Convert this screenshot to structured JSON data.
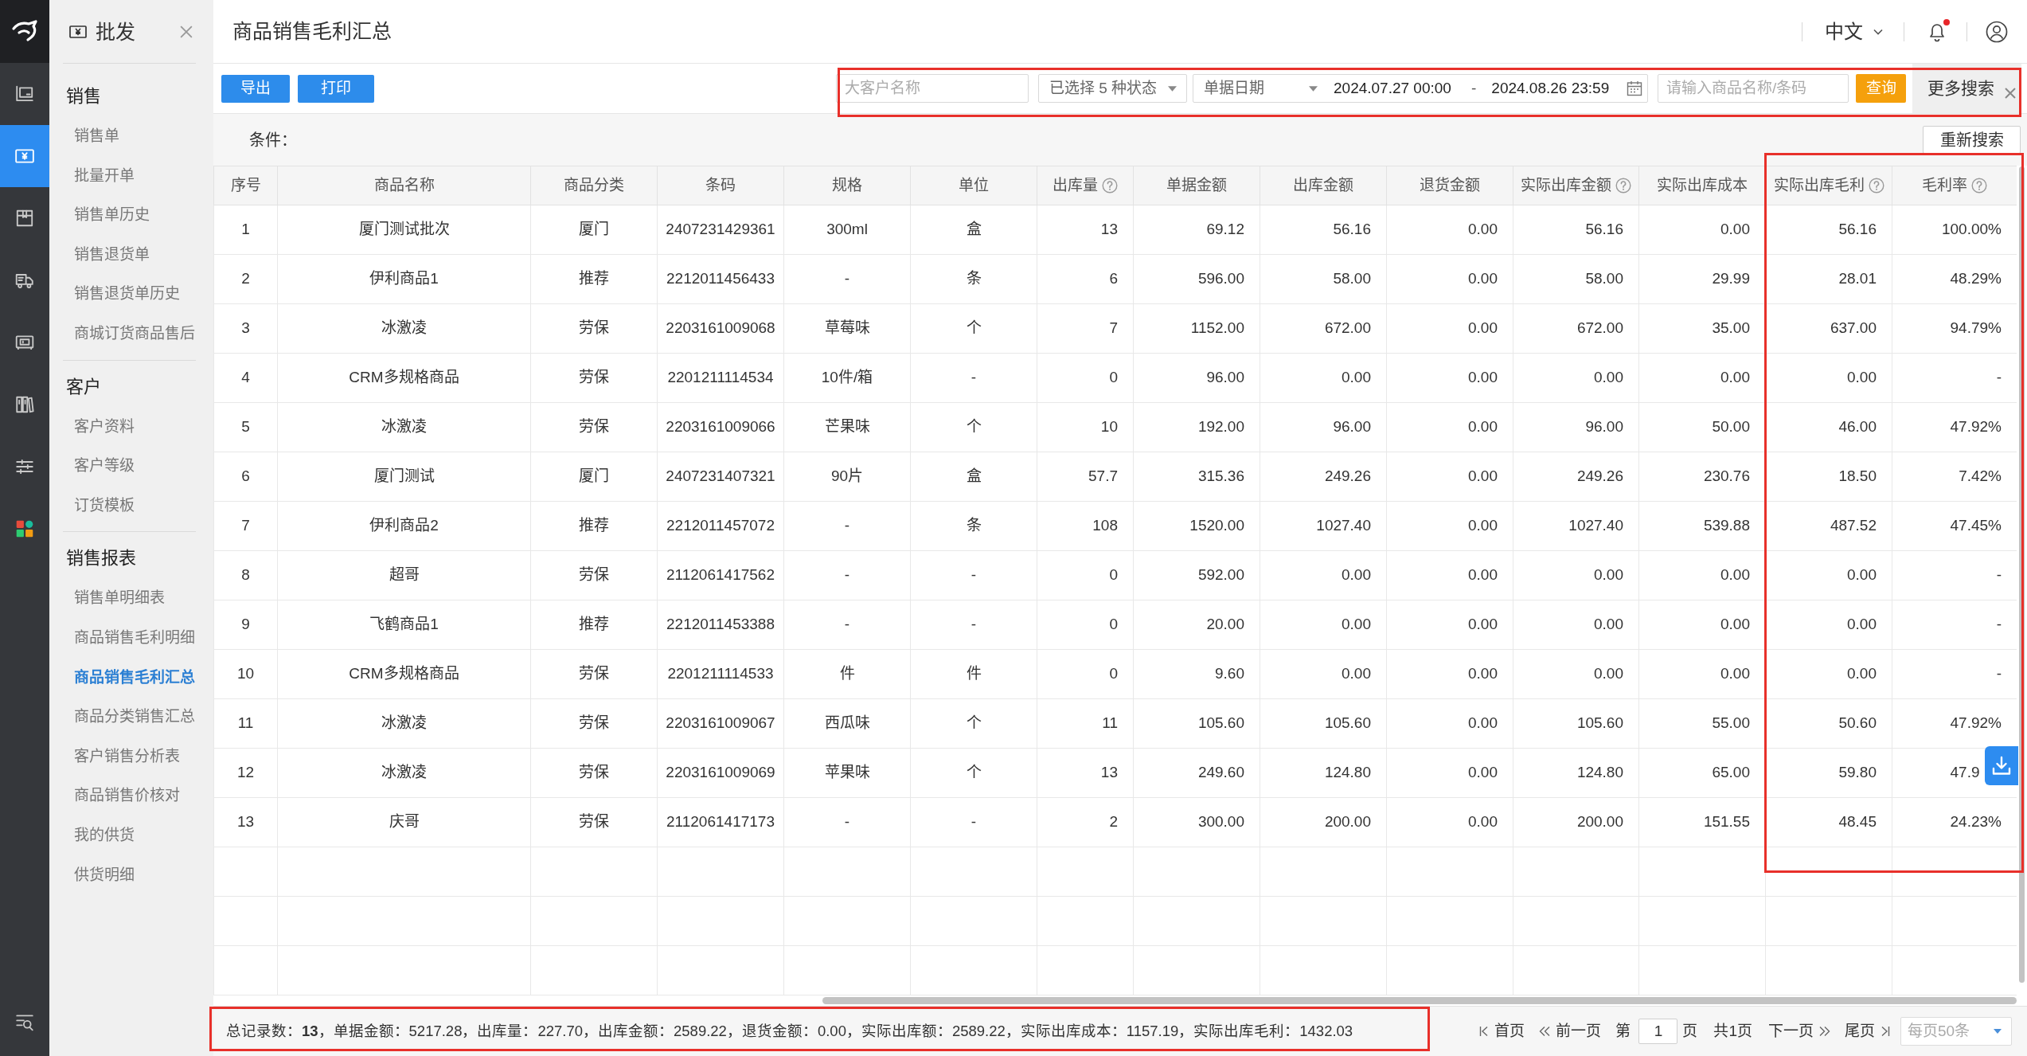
{
  "rail": {
    "items": [
      {
        "selected": false
      },
      {
        "selected": true
      },
      {
        "selected": false
      },
      {
        "selected": false
      },
      {
        "selected": false
      },
      {
        "selected": false
      },
      {
        "selected": false
      },
      {
        "selected": false
      }
    ]
  },
  "sidebar": {
    "title": "批发",
    "sections": [
      {
        "title": "销售",
        "items": [
          {
            "label": "销售单",
            "selected": false
          },
          {
            "label": "批量开单",
            "selected": false
          },
          {
            "label": "销售单历史",
            "selected": false
          },
          {
            "label": "销售退货单",
            "selected": false
          },
          {
            "label": "销售退货单历史",
            "selected": false
          },
          {
            "label": "商城订货商品售后",
            "selected": false
          }
        ]
      },
      {
        "title": "客户",
        "items": [
          {
            "label": "客户资料",
            "selected": false
          },
          {
            "label": "客户等级",
            "selected": false
          },
          {
            "label": "订货模板",
            "selected": false
          }
        ]
      },
      {
        "title": "销售报表",
        "items": [
          {
            "label": "销售单明细表",
            "selected": false
          },
          {
            "label": "商品销售毛利明细",
            "selected": false
          },
          {
            "label": "商品销售毛利汇总",
            "selected": true
          },
          {
            "label": "商品分类销售汇总",
            "selected": false
          },
          {
            "label": "客户销售分析表",
            "selected": false
          },
          {
            "label": "商品销售价核对",
            "selected": false
          },
          {
            "label": "我的供货",
            "selected": false
          },
          {
            "label": "供货明细",
            "selected": false
          }
        ]
      }
    ]
  },
  "header": {
    "title": "商品销售毛利汇总",
    "language": "中文",
    "notifications": {
      "unread": true
    }
  },
  "toolbar": {
    "buttons": [
      "导出",
      "打印"
    ]
  },
  "filter_bar": {
    "highlighted": true,
    "customer": {
      "placeholder": "大客户名称"
    },
    "status": {
      "value": "已选择 5 种状态"
    },
    "date_type": {
      "value": "单据日期"
    },
    "date_from": "2024.07.27 00:00",
    "date_separator": "-",
    "date_to": "2024.08.26 23:59",
    "product": {
      "placeholder": "请输入商品名称/条码"
    },
    "search_button": "查询",
    "more_button": "更多搜索"
  },
  "conditions": {
    "label": "条件：",
    "reset_button": "重新搜索"
  },
  "table": {
    "columns": [
      {
        "label": "序号",
        "kind": "text",
        "help": false,
        "highlighted": false
      },
      {
        "label": "商品名称",
        "kind": "text",
        "help": false,
        "highlighted": false
      },
      {
        "label": "商品分类",
        "kind": "text",
        "help": false,
        "highlighted": false
      },
      {
        "label": "条码",
        "kind": "text",
        "help": false,
        "highlighted": false
      },
      {
        "label": "规格",
        "kind": "text",
        "help": false,
        "highlighted": false
      },
      {
        "label": "单位",
        "kind": "text",
        "help": false,
        "highlighted": false
      },
      {
        "label": "出库量",
        "kind": "number",
        "help": true,
        "highlighted": false
      },
      {
        "label": "单据金额",
        "kind": "number",
        "help": false,
        "highlighted": false
      },
      {
        "label": "出库金额",
        "kind": "number",
        "help": false,
        "highlighted": false
      },
      {
        "label": "退货金额",
        "kind": "number",
        "help": false,
        "highlighted": false
      },
      {
        "label": "实际出库金额",
        "kind": "number",
        "help": true,
        "highlighted": false
      },
      {
        "label": "实际出库成本",
        "kind": "number",
        "help": false,
        "highlighted": false
      },
      {
        "label": "实际出库毛利",
        "kind": "number",
        "help": true,
        "highlighted": true
      },
      {
        "label": "毛利率",
        "kind": "number",
        "help": true,
        "highlighted": true
      }
    ],
    "rows": [
      [
        "1",
        "厦门测试批次",
        "厦门",
        "2407231429361",
        "300ml",
        "盒",
        "13",
        "69.12",
        "56.16",
        "0.00",
        "56.16",
        "0.00",
        "56.16",
        "100.00%"
      ],
      [
        "2",
        "伊利商品1",
        "推荐",
        "2212011456433",
        "-",
        "条",
        "6",
        "596.00",
        "58.00",
        "0.00",
        "58.00",
        "29.99",
        "28.01",
        "48.29%"
      ],
      [
        "3",
        "冰激凌",
        "劳保",
        "2203161009068",
        "草莓味",
        "个",
        "7",
        "1152.00",
        "672.00",
        "0.00",
        "672.00",
        "35.00",
        "637.00",
        "94.79%"
      ],
      [
        "4",
        "CRM多规格商品",
        "劳保",
        "2201211114534",
        "10件/箱",
        "-",
        "0",
        "96.00",
        "0.00",
        "0.00",
        "0.00",
        "0.00",
        "0.00",
        "-"
      ],
      [
        "5",
        "冰激凌",
        "劳保",
        "2203161009066",
        "芒果味",
        "个",
        "10",
        "192.00",
        "96.00",
        "0.00",
        "96.00",
        "50.00",
        "46.00",
        "47.92%"
      ],
      [
        "6",
        "厦门测试",
        "厦门",
        "2407231407321",
        "90片",
        "盒",
        "57.7",
        "315.36",
        "249.26",
        "0.00",
        "249.26",
        "230.76",
        "18.50",
        "7.42%"
      ],
      [
        "7",
        "伊利商品2",
        "推荐",
        "2212011457072",
        "-",
        "条",
        "108",
        "1520.00",
        "1027.40",
        "0.00",
        "1027.40",
        "539.88",
        "487.52",
        "47.45%"
      ],
      [
        "8",
        "超哥",
        "劳保",
        "2112061417562",
        "-",
        "-",
        "0",
        "592.00",
        "0.00",
        "0.00",
        "0.00",
        "0.00",
        "0.00",
        "-"
      ],
      [
        "9",
        "飞鹤商品1",
        "推荐",
        "2212011453388",
        "-",
        "-",
        "0",
        "20.00",
        "0.00",
        "0.00",
        "0.00",
        "0.00",
        "0.00",
        "-"
      ],
      [
        "10",
        "CRM多规格商品",
        "劳保",
        "2201211114533",
        "件",
        "件",
        "0",
        "9.60",
        "0.00",
        "0.00",
        "0.00",
        "0.00",
        "0.00",
        "-"
      ],
      [
        "11",
        "冰激凌",
        "劳保",
        "2203161009067",
        "西瓜味",
        "个",
        "11",
        "105.60",
        "105.60",
        "0.00",
        "105.60",
        "55.00",
        "50.60",
        "47.92%"
      ],
      [
        "12",
        "冰激凌",
        "劳保",
        "2203161009069",
        "苹果味",
        "个",
        "13",
        "249.60",
        "124.80",
        "0.00",
        "124.80",
        "65.00",
        "59.80",
        "47.9"
      ],
      [
        "13",
        "庆哥",
        "劳保",
        "2112061417173",
        "-",
        "-",
        "2",
        "300.00",
        "200.00",
        "0.00",
        "200.00",
        "151.55",
        "48.45",
        "24.23%"
      ]
    ]
  },
  "summary": {
    "highlighted": true,
    "text": "总记录数：**13**，单据金额：5217.28，出库量：227.70，出库金额：2589.22，退货金额：0.00，实际出库额：2589.22，实际出库成本：1157.19，实际出库毛利：1432.03"
  },
  "pagination": {
    "first": "首页",
    "prev": "前一页",
    "page_before": "第",
    "page": "1",
    "page_after": "页",
    "total": "共1页",
    "next": "下一页",
    "last": "尾页",
    "page_size": "每页50条"
  }
}
